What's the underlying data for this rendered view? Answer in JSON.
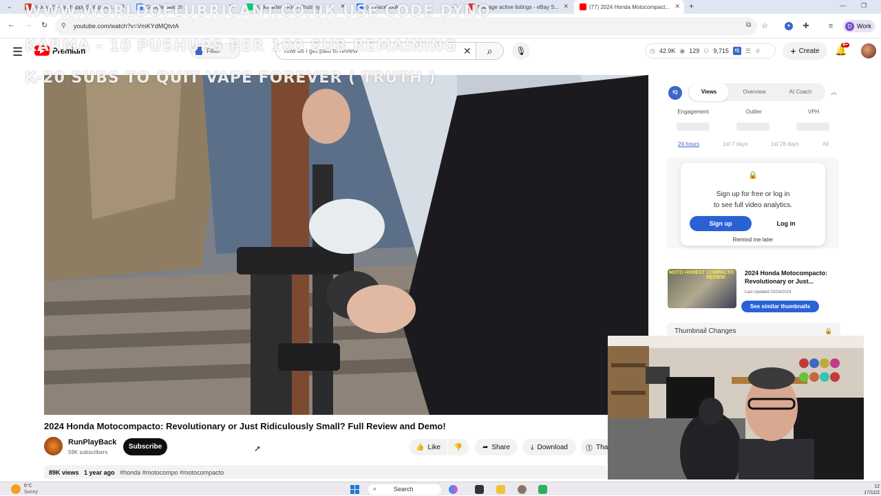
{
  "browser": {
    "tabs": [
      {
        "label": "Inbox (2) - jamhappy@btopenw...",
        "fav": "#d93025"
      },
      {
        "label": "Google Search",
        "fav": "#4285f4"
      },
      {
        "label": "Kickstarter - Rich Chutneys",
        "fav": "#05ce78"
      },
      {
        "label": "(4) Facebook",
        "fav": "#1877f2"
      },
      {
        "label": "Manage active listings - eBay S...",
        "fav": "#e53238"
      },
      {
        "label": "(77) 2024 Honda Motocompact...",
        "fav": "#ff0000"
      }
    ],
    "new_tab": "+",
    "url": "youtube.com/watch?v=VmKYdMQtvtA",
    "profile_initial": "D",
    "profile_label": "Work"
  },
  "watermark": {
    "line1": "WWW.WORLDOFLUBRICANT.CO.UK USE CODE DYNO",
    "line2": "KARMA - 10 PUSHUPS PER 100 SUB REMAINING",
    "line3": "K-20 SUBS TO QUIT VAPE FOREVER ( TRUTH )"
  },
  "youtube": {
    "logo_word": "Premium",
    "filter_label": "Filter",
    "search_value": "how do i get paid to review",
    "stats": {
      "views": "42.9K",
      "watching": "129",
      "subs": "9,715",
      "iq": "IQ"
    },
    "create_label": "Create",
    "notifications": "9+"
  },
  "video": {
    "title": "2024 Honda Motocompacto: Revolutionary or Just Ridiculously Small? Full Review and Demo!",
    "channel": "RunPlayBack",
    "subscribers": "59K subscribers",
    "subscribe_label": "Subscribe",
    "like_label": "Like",
    "share_label": "Share",
    "download_label": "Download",
    "thanks_label": "Thanks",
    "views": "89K views",
    "age": "1 year ago",
    "tags": "#honda #motocompo #motocompacto"
  },
  "vidiq": {
    "logo": "IQ",
    "tabs": [
      "Views",
      "Overview",
      "AI Coach"
    ],
    "metrics": [
      "Engagement",
      "Outlier",
      "VPH"
    ],
    "ranges": [
      "24 hours",
      "1st 7 days",
      "1st 28 days",
      "All"
    ],
    "signup_line1": "Sign up for free or log in",
    "signup_line2": "to see full video analytics.",
    "signup_btn": "Sign up",
    "login_btn": "Log in",
    "remind": "Remind me later",
    "thumb_text_left": "MOTO HONEST",
    "thumb_text_right": "COMPACTO REVIEW",
    "thumb_title": "2024 Honda Motocompacto: Revolutionary or Just...",
    "thumb_updated": "Last Updated 02/24/2024",
    "similar_btn": "See similar thumbnails",
    "thumb_changes": "Thumbnail Changes"
  },
  "taskbar": {
    "temp": "6°C",
    "weather": "Sunny",
    "search": "Search",
    "time": "12",
    "date": "17/11/2"
  }
}
